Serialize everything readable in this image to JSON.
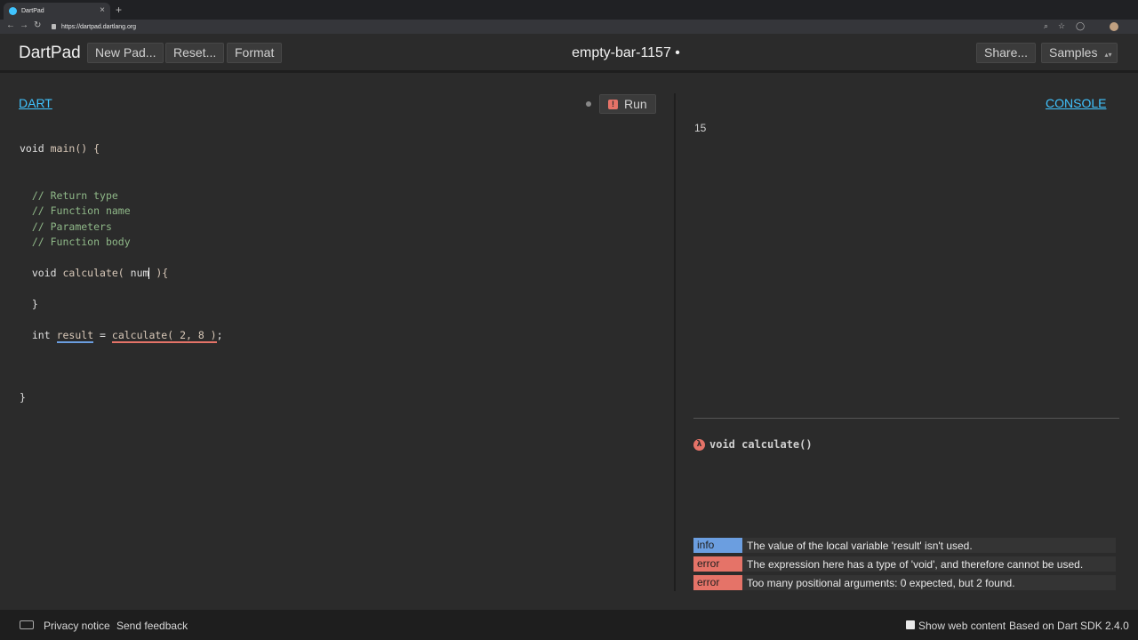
{
  "browser": {
    "tab_title": "DartPad",
    "tab_close": "×",
    "new_tab": "+",
    "url": "https://dartpad.dartlang.org"
  },
  "header": {
    "brand": "DartPad",
    "new_pad": "New Pad...",
    "reset": "Reset...",
    "format": "Format",
    "pad_name": "empty-bar-1157 •",
    "share": "Share...",
    "samples": "Samples"
  },
  "editor": {
    "tab_label": "DART",
    "run_label": "Run",
    "run_error_glyph": "!",
    "code": {
      "l1_kw": "void",
      "l1_rest": " main() {",
      "c1": "// Return type",
      "c2": "// Function name",
      "c3": "// Parameters",
      "c4": "// Function body",
      "l8_kw": "void",
      "l8_fn": " calculate( ",
      "l8_param": "num",
      "l8_end": " ){",
      "l10": "}",
      "l12_kw": "int",
      "l12_var": "result",
      "l12_eq": " = ",
      "l12_call": "calculate( 2, 8 )",
      "l12_end": ";",
      "l16": "}"
    }
  },
  "console": {
    "tab_label": "CONSOLE",
    "output": "15",
    "doc_glyph": "λ",
    "doc_signature": "void calculate()"
  },
  "issues": [
    {
      "kind": "info",
      "message": "The value of the local variable 'result' isn't used."
    },
    {
      "kind": "error",
      "message": "The expression here has a type of 'void', and therefore cannot be used."
    },
    {
      "kind": "error",
      "message": "Too many positional arguments: 0 expected, but 2 found."
    }
  ],
  "footer": {
    "privacy": "Privacy notice",
    "feedback": "Send feedback",
    "show_web": "Show web content",
    "sdk": "Based on Dart SDK 2.4.0"
  },
  "colors": {
    "accent": "#40c4ff",
    "info": "#6b9ee0",
    "error": "#e57368"
  },
  "icons": [
    "back-icon",
    "forward-icon",
    "reload-icon",
    "lock-icon",
    "zoom-icon",
    "star-icon",
    "keyboard-icon",
    "lambda-icon",
    "error-icon"
  ]
}
